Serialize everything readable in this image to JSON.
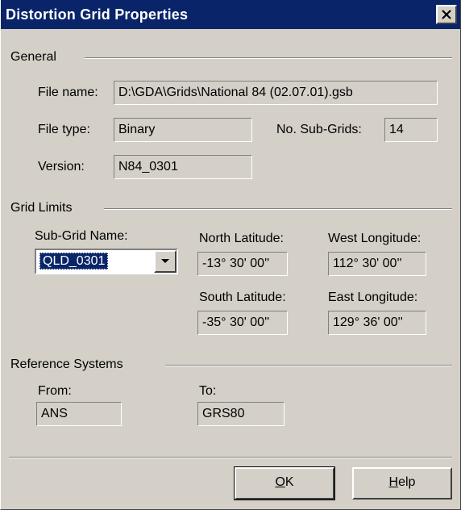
{
  "window": {
    "title": "Distortion Grid Properties",
    "close_icon": "close-icon"
  },
  "general": {
    "legend": "General",
    "file_name_label": "File name:",
    "file_name_value": "D:\\GDA\\Grids\\National 84 (02.07.01).gsb",
    "file_type_label": "File type:",
    "file_type_value": "Binary",
    "sub_grids_label": "No. Sub-Grids:",
    "sub_grids_value": "14",
    "version_label": "Version:",
    "version_value": "N84_0301"
  },
  "grid_limits": {
    "legend": "Grid Limits",
    "sub_grid_name_label": "Sub-Grid Name:",
    "sub_grid_name_value": "QLD_0301",
    "north_latitude_label": "North Latitude:",
    "north_latitude_value": "-13° 30' 00''",
    "west_longitude_label": "West Longitude:",
    "west_longitude_value": "112° 30' 00''",
    "south_latitude_label": "South Latitude:",
    "south_latitude_value": "-35° 30' 00''",
    "east_longitude_label": "East Longitude:",
    "east_longitude_value": "129° 36' 00''"
  },
  "reference_systems": {
    "legend": "Reference Systems",
    "from_label": "From:",
    "from_value": "ANS",
    "to_label": "To:",
    "to_value": "GRS80"
  },
  "buttons": {
    "ok_mnemonic": "O",
    "ok_rest": "K",
    "help_mnemonic": "H",
    "help_rest": "elp"
  },
  "colors": {
    "titlebar": "#0a246a",
    "face": "#d4d0c8",
    "selection": "#0a246a"
  }
}
